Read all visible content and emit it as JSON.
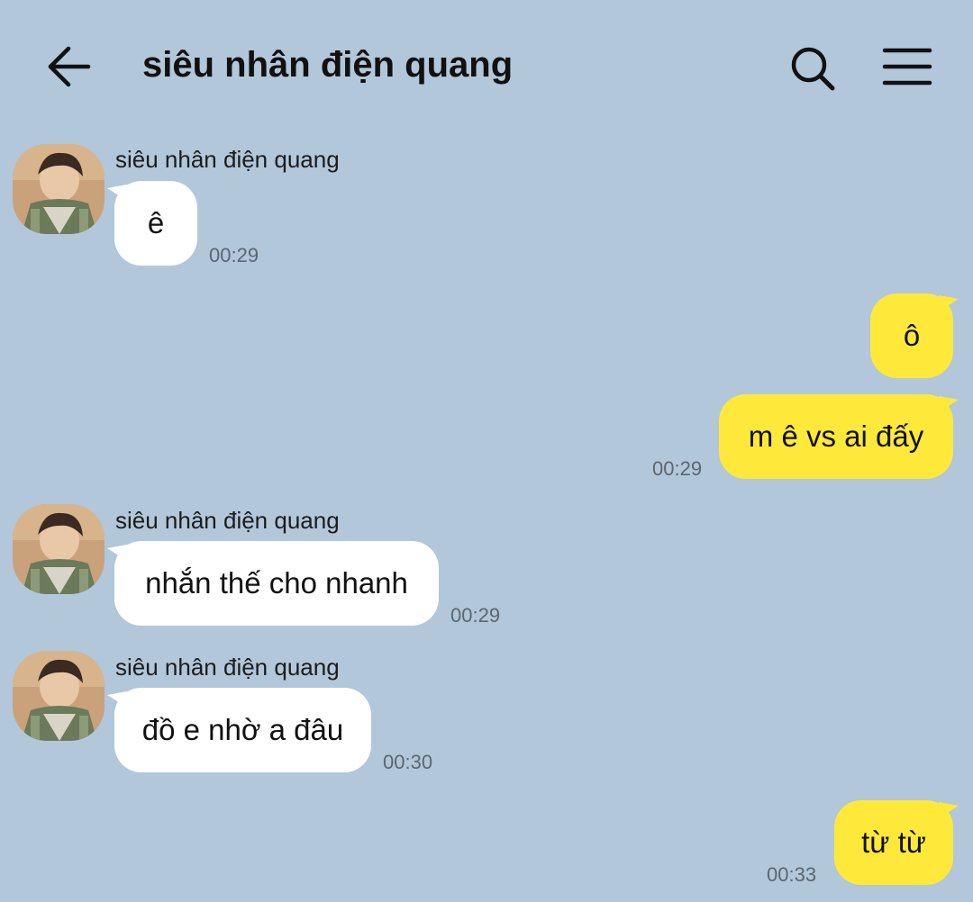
{
  "header": {
    "title": "siêu nhân điện quang",
    "back_icon": "arrow-left-icon",
    "search_icon": "search-icon",
    "menu_icon": "hamburger-menu-icon"
  },
  "colors": {
    "background": "#b2c7da",
    "incoming_bubble": "#ffffff",
    "outgoing_bubble": "#fee93b"
  },
  "messages": [
    {
      "direction": "in",
      "sender": "siêu nhân điện quang",
      "text": "ê",
      "time": "00:29"
    },
    {
      "direction": "out",
      "text": "ô",
      "time": ""
    },
    {
      "direction": "out",
      "text": "m ê vs ai đấy",
      "time": "00:29"
    },
    {
      "direction": "in",
      "sender": "siêu nhân điện quang",
      "text": "nhắn thế cho nhanh",
      "time": "00:29"
    },
    {
      "direction": "in",
      "sender": "siêu nhân điện quang",
      "text": "đồ e nhờ a đâu",
      "time": "00:30"
    },
    {
      "direction": "out",
      "text": "từ từ",
      "time": "00:33"
    }
  ]
}
